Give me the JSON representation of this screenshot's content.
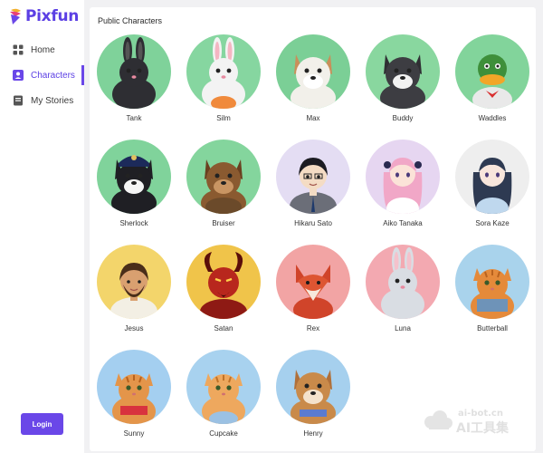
{
  "app": {
    "name": "Pixfun",
    "brand_color": "#6a47e8"
  },
  "nav": [
    {
      "label": "Home",
      "icon": "grid-icon",
      "active": false
    },
    {
      "label": "Characters",
      "icon": "user-badge-icon",
      "active": true
    },
    {
      "label": "My Stories",
      "icon": "book-icon",
      "active": false
    }
  ],
  "login_label": "Login",
  "section_title": "Public Characters",
  "characters": [
    {
      "name": "Tank",
      "bg": "#7fd29a",
      "subject": "black rabbit"
    },
    {
      "name": "Silm",
      "bg": "#86d6a0",
      "subject": "white rabbit"
    },
    {
      "name": "Max",
      "bg": "#7bcf96",
      "subject": "bulldog"
    },
    {
      "name": "Buddy",
      "bg": "#89d79f",
      "subject": "husky"
    },
    {
      "name": "Waddles",
      "bg": "#82d49b",
      "subject": "duck"
    },
    {
      "name": "Sherlock",
      "bg": "#80d39b",
      "subject": "police dog"
    },
    {
      "name": "Bruiser",
      "bg": "#84d59d",
      "subject": "bear"
    },
    {
      "name": "Hikaru Sato",
      "bg": "#e4ddf3",
      "subject": "anime boy"
    },
    {
      "name": "Aiko Tanaka",
      "bg": "#e6d6f1",
      "subject": "anime girl pink"
    },
    {
      "name": "Sora Kaze",
      "bg": "#eeeeee",
      "subject": "anime girl blue"
    },
    {
      "name": "Jesus",
      "bg": "#f3d56b",
      "subject": "bearded man"
    },
    {
      "name": "Satan",
      "bg": "#f0c44a",
      "subject": "red devil"
    },
    {
      "name": "Rex",
      "bg": "#f2a4a4",
      "subject": "red fox"
    },
    {
      "name": "Luna",
      "bg": "#f3a9b1",
      "subject": "grey rabbit"
    },
    {
      "name": "Butterball",
      "bg": "#a9d3ec",
      "subject": "fat cat"
    },
    {
      "name": "Sunny",
      "bg": "#a4cff0",
      "subject": "muscle cat"
    },
    {
      "name": "Cupcake",
      "bg": "#a8d2ef",
      "subject": "kitten"
    },
    {
      "name": "Henry",
      "bg": "#a6d0ee",
      "subject": "shiba"
    }
  ],
  "watermark": {
    "line1": "ai-bot.cn",
    "line2": "AI工具集"
  }
}
